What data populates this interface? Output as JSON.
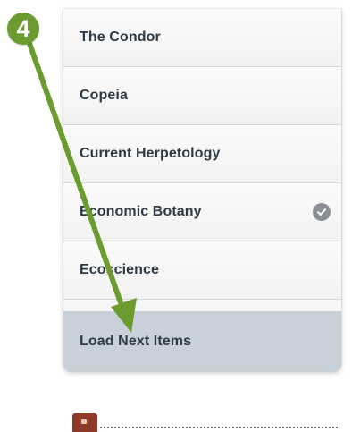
{
  "list": {
    "items": [
      {
        "label": "The Condor",
        "checked": false
      },
      {
        "label": "Copeia",
        "checked": false
      },
      {
        "label": "Current Herpetology",
        "checked": false
      },
      {
        "label": "Economic Botany",
        "checked": true
      },
      {
        "label": "Ecoscience",
        "checked": false
      }
    ],
    "load_more_label": "Load Next Items"
  },
  "annotation": {
    "step_number": "4",
    "accent_color": "#6c9c2f"
  },
  "icons": {
    "check": "checkmark-circle-icon",
    "tag": "bookmark-tag-icon"
  },
  "colors": {
    "list_text": "#2d3a45",
    "load_more_background": "#c8d0d9",
    "check_badge": "#8b8f94"
  }
}
